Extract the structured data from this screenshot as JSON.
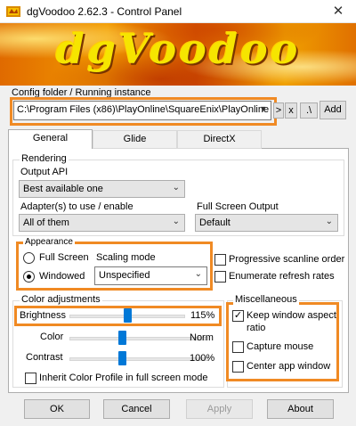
{
  "window": {
    "title": "dgVoodoo 2.62.3 - Control Panel",
    "close_glyph": "✕",
    "banner_logo": "dgVoodoo"
  },
  "config": {
    "label": "Config folder / Running instance",
    "path": "C:\\Program Files (x86)\\PlayOnline\\SquareEnix\\PlayOnline",
    "btn_next": ">",
    "btn_remove": "x",
    "btn_current": ".\\",
    "btn_add": "Add"
  },
  "tabs": [
    "General",
    "Glide",
    "DirectX"
  ],
  "rendering": {
    "label": "Rendering",
    "output_api_label": "Output API",
    "output_api_value": "Best available one",
    "adapter_label": "Adapter(s) to use / enable",
    "adapter_value": "All of them",
    "fullscreen_output_label": "Full Screen Output",
    "fullscreen_output_value": "Default"
  },
  "appearance": {
    "label": "Appearance",
    "full_screen": "Full Screen",
    "windowed": "Windowed",
    "selected": "windowed",
    "scaling_label": "Scaling mode",
    "scaling_value": "Unspecified",
    "progressive": "Progressive scanline order",
    "enumerate": "Enumerate refresh rates"
  },
  "color": {
    "label": "Color adjustments",
    "brightness_label": "Brightness",
    "brightness_value": "115%",
    "brightness_level": 0.5,
    "color_label": "Color",
    "color_value": "Norm",
    "color_level": 0.38,
    "contrast_label": "Contrast",
    "contrast_value": "100%",
    "contrast_level": 0.38,
    "inherit": "Inherit Color Profile in full screen mode"
  },
  "misc": {
    "label": "Miscellaneous",
    "keep_aspect_1": "Keep window aspect",
    "keep_aspect_2": "ratio",
    "keep_aspect_checked": true,
    "capture_mouse": "Capture mouse",
    "center_window": "Center app window",
    "check_glyph": "✓"
  },
  "buttons": {
    "ok": "OK",
    "cancel": "Cancel",
    "apply": "Apply",
    "about": "About"
  },
  "colors": {
    "highlight": "#f08a24",
    "slider_thumb": "#0078d7"
  }
}
